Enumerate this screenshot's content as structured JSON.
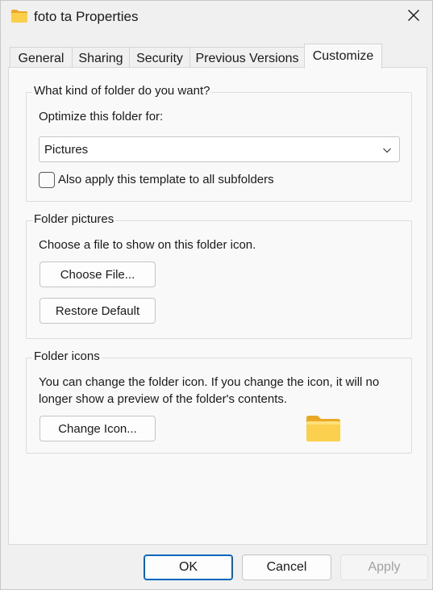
{
  "window": {
    "title": "foto ta Properties"
  },
  "tabs": [
    {
      "label": "General"
    },
    {
      "label": "Sharing"
    },
    {
      "label": "Security"
    },
    {
      "label": "Previous Versions"
    },
    {
      "label": "Customize",
      "active": true
    }
  ],
  "folder_type": {
    "group_title": "What kind of folder do you want?",
    "optimize_label": "Optimize this folder for:",
    "selected_value": "Pictures",
    "subfolders_checkbox_label": "Also apply this template to all subfolders",
    "subfolders_checked": false
  },
  "folder_pictures": {
    "group_title": "Folder pictures",
    "description": "Choose a file to show on this folder icon.",
    "choose_file_label": "Choose File...",
    "restore_default_label": "Restore Default"
  },
  "folder_icons": {
    "group_title": "Folder icons",
    "description_line1": "You can change the folder icon. If you change the icon, it will no",
    "description_line2": "longer show a preview of the folder's contents.",
    "change_icon_label": "Change Icon..."
  },
  "footer": {
    "ok_label": "OK",
    "cancel_label": "Cancel",
    "apply_label": "Apply",
    "apply_enabled": false
  },
  "colors": {
    "accent": "#0067c0",
    "folder_yellow": "#f8c431"
  },
  "icons": {
    "title": "folder-icon",
    "close": "close-icon",
    "dropdown": "chevron-down-icon",
    "preview": "folder-icon"
  }
}
